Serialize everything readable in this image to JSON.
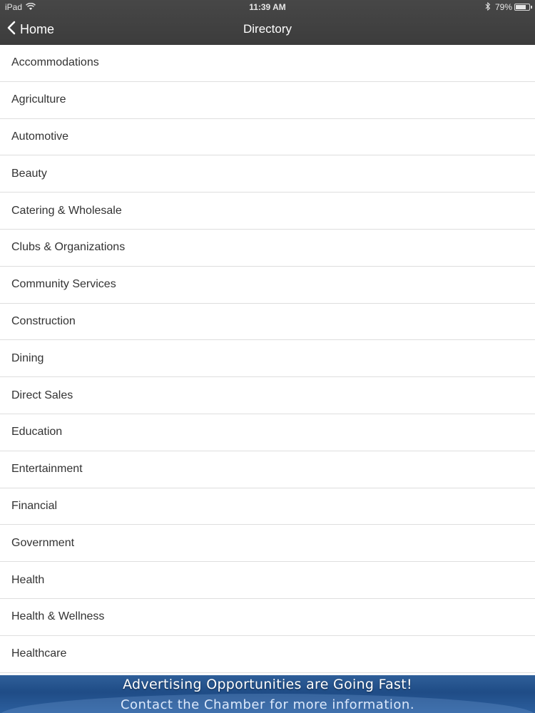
{
  "status_bar": {
    "device": "iPad",
    "time": "11:39 AM",
    "battery_percent": "79%",
    "battery_level": 0.79,
    "icons": [
      "wifi-icon",
      "bluetooth-icon",
      "battery-icon"
    ]
  },
  "nav": {
    "back_label": "Home",
    "title": "Directory"
  },
  "directory": {
    "items": [
      {
        "label": "Accommodations"
      },
      {
        "label": "Agriculture"
      },
      {
        "label": "Automotive"
      },
      {
        "label": "Beauty"
      },
      {
        "label": "Catering & Wholesale"
      },
      {
        "label": "Clubs & Organizations"
      },
      {
        "label": "Community Services"
      },
      {
        "label": "Construction"
      },
      {
        "label": "Dining"
      },
      {
        "label": "Direct Sales"
      },
      {
        "label": "Education"
      },
      {
        "label": "Entertainment"
      },
      {
        "label": "Financial"
      },
      {
        "label": "Government"
      },
      {
        "label": "Health"
      },
      {
        "label": "Health & Wellness"
      },
      {
        "label": "Healthcare"
      }
    ]
  },
  "ad_banner": {
    "line1": "Advertising Opportunities are Going Fast!",
    "line2": "Contact the Chamber for more information."
  },
  "colors": {
    "nav_bar": "#424242",
    "banner": "#24518c",
    "divider": "#dedede",
    "item_text": "#333333"
  }
}
